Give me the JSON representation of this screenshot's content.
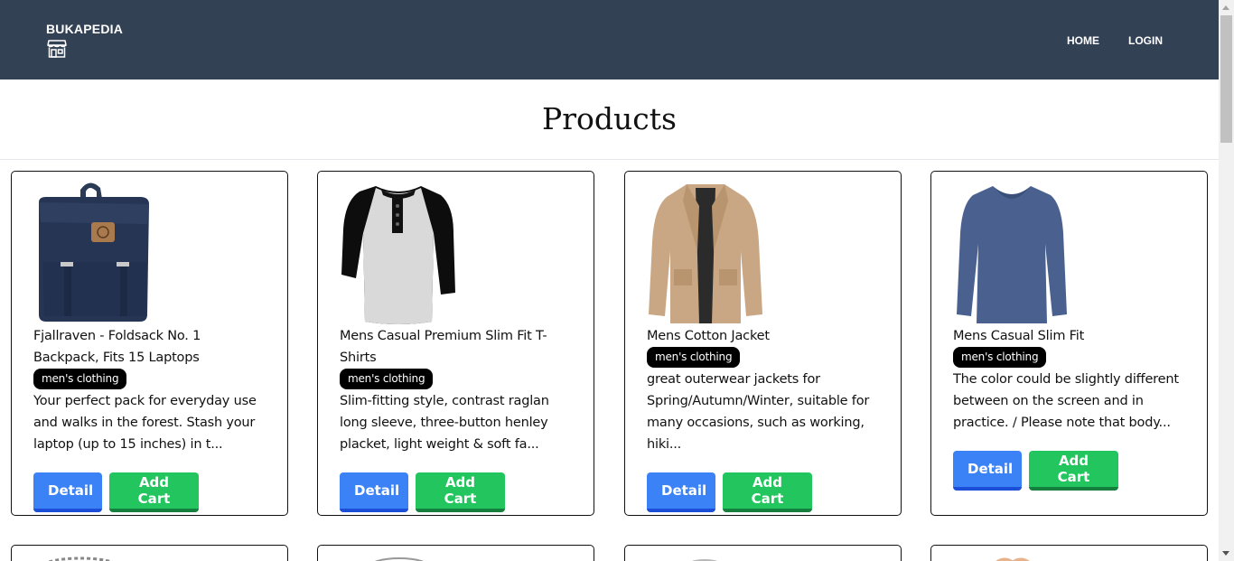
{
  "navbar": {
    "brand": "BUKAPEDIA",
    "brand_icon": "store-icon",
    "links": [
      "HOME",
      "LOGIN"
    ],
    "background": "#334155"
  },
  "header": {
    "title": "Products"
  },
  "products": [
    {
      "title": "Fjallraven - Foldsack No. 1 Backpack, Fits 15 Laptops",
      "category": "men's clothing",
      "description": "Your perfect pack for everyday use and walks in the forest. Stash your laptop (up to 15 inches) in t...",
      "image_icon": "backpack-image",
      "detail_label": "Detail",
      "cart_label": "Add Cart"
    },
    {
      "title": "Mens Casual Premium Slim Fit T-Shirts",
      "category": "men's clothing",
      "description": "Slim-fitting style, contrast raglan long sleeve, three-button henley placket, light weight & soft fa...",
      "image_icon": "raglan-shirt-image",
      "detail_label": "Detail",
      "cart_label": "Add Cart"
    },
    {
      "title": "Mens Cotton Jacket",
      "category": "men's clothing",
      "description": "great outerwear jackets for Spring/Autumn/Winter, suitable for many occasions, such as working, hiki...",
      "image_icon": "jacket-image",
      "detail_label": "Detail",
      "cart_label": "Add Cart"
    },
    {
      "title": "Mens Casual Slim Fit",
      "category": "men's clothing",
      "description": "The color could be slightly different between on the screen and in practice. / Please note that body...",
      "image_icon": "long-sleeve-shirt-image",
      "detail_label": "Detail",
      "cart_label": "Add Cart"
    }
  ],
  "colors": {
    "detail_button": "#3b82f6",
    "cart_button": "#22c55e",
    "badge": "#000000"
  }
}
